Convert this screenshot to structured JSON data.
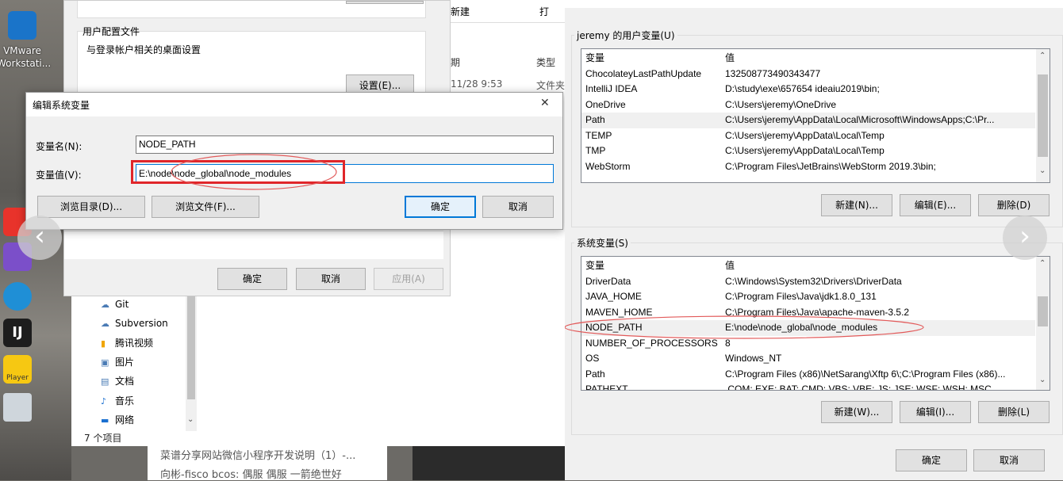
{
  "desktop": {
    "vmware_label": "VMware Workstati...",
    "player_label": "Player"
  },
  "profile_window": {
    "group_title": "用户配置文件",
    "group_desc": "与登录帐户相关的桌面设置",
    "settings_button": "设置(E)...",
    "ok": "确定",
    "cancel": "取消",
    "apply": "应用(A)"
  },
  "explorer": {
    "header_new": "新建",
    "header_open": "打",
    "col_date": "期",
    "col_type": "类型",
    "row_date": "11/28 9:53",
    "row_type": "文件夹",
    "tree": [
      {
        "icon": "☁",
        "label": "Git"
      },
      {
        "icon": "☁",
        "label": "Subversion"
      },
      {
        "icon": "▮",
        "label": "腾讯视频"
      },
      {
        "icon": "▣",
        "label": "图片"
      },
      {
        "icon": "▤",
        "label": "文档"
      },
      {
        "icon": "♪",
        "label": "音乐"
      },
      {
        "icon": "▬",
        "label": "网络"
      }
    ],
    "status": "7 个项目"
  },
  "background_web": {
    "line1": "菜谱分享网站微信小程序开发说明（1）-...",
    "line2": "向彬-fisco bcos: 偶服    偶服    一箭绝世好"
  },
  "edit_dialog": {
    "title": "编辑系统变量",
    "close": "✕",
    "name_label": "变量名(N):",
    "name_value": "NODE_PATH",
    "value_label": "变量值(V):",
    "value_value": "E:\\node\\node_global\\node_modules",
    "browse_dir": "浏览目录(D)...",
    "browse_file": "浏览文件(F)...",
    "ok": "确定",
    "cancel": "取消"
  },
  "env_window": {
    "user_group_title": "jeremy 的用户变量(U)",
    "user_columns": [
      "变量",
      "值"
    ],
    "user_vars": [
      {
        "name": "ChocolateyLastPathUpdate",
        "value": "132508773490343477"
      },
      {
        "name": "IntelliJ IDEA",
        "value": "D:\\study\\exe\\657654 ideaiu2019\\bin;"
      },
      {
        "name": "OneDrive",
        "value": "C:\\Users\\jeremy\\OneDrive"
      },
      {
        "name": "Path",
        "value": "C:\\Users\\jeremy\\AppData\\Local\\Microsoft\\WindowsApps;C:\\Pr..."
      },
      {
        "name": "TEMP",
        "value": "C:\\Users\\jeremy\\AppData\\Local\\Temp"
      },
      {
        "name": "TMP",
        "value": "C:\\Users\\jeremy\\AppData\\Local\\Temp"
      },
      {
        "name": "WebStorm",
        "value": "C:\\Program Files\\JetBrains\\WebStorm 2019.3\\bin;"
      }
    ],
    "user_new": "新建(N)...",
    "user_edit": "编辑(E)...",
    "user_delete": "删除(D)",
    "sys_group_title": "系统变量(S)",
    "sys_columns": [
      "变量",
      "值"
    ],
    "sys_vars": [
      {
        "name": "DriverData",
        "value": "C:\\Windows\\System32\\Drivers\\DriverData"
      },
      {
        "name": "JAVA_HOME",
        "value": "C:\\Program Files\\Java\\jdk1.8.0_131"
      },
      {
        "name": "MAVEN_HOME",
        "value": "C:\\Program Files\\Java\\apache-maven-3.5.2"
      },
      {
        "name": "NODE_PATH",
        "value": "E:\\node\\node_global\\node_modules"
      },
      {
        "name": "NUMBER_OF_PROCESSORS",
        "value": "8"
      },
      {
        "name": "OS",
        "value": "Windows_NT"
      },
      {
        "name": "Path",
        "value": "C:\\Program Files (x86)\\NetSarang\\Xftp 6\\;C:\\Program Files (x86)..."
      },
      {
        "name": "PATHEXT",
        "value": ".COM;.EXE;.BAT;.CMD;.VBS;.VBE;.JS;.JSE;.WSF;.WSH;.MSC"
      }
    ],
    "sys_new": "新建(W)...",
    "sys_edit": "编辑(I)...",
    "sys_delete": "删除(L)",
    "ok": "确定",
    "cancel": "取消"
  },
  "nav": {
    "prev": "‹",
    "next": "›"
  },
  "colors": {
    "accent": "#0078d7",
    "highlight_red": "#e0262a",
    "annotation": "#e25a5a"
  }
}
